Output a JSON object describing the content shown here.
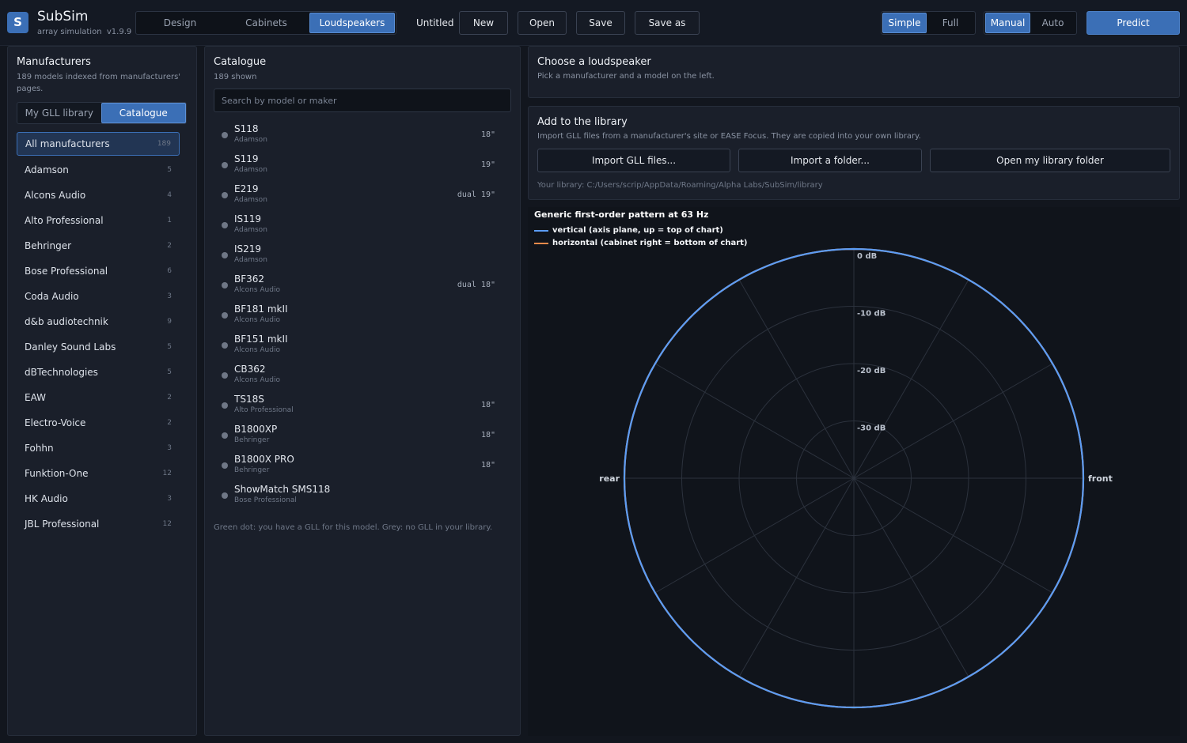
{
  "app": {
    "logo_letter": "S",
    "name": "SubSim",
    "subtitle": "array simulation",
    "version": "v1.9.9"
  },
  "topbar": {
    "mode_tabs": [
      {
        "label": "Design",
        "active": false
      },
      {
        "label": "Cabinets",
        "active": false
      },
      {
        "label": "Loudspeakers",
        "active": true
      }
    ],
    "document_title": "Untitled",
    "buttons": {
      "new": "New",
      "open": "Open",
      "save": "Save",
      "save_as": "Save as"
    },
    "view_toggle": [
      {
        "label": "Simple",
        "active": true
      },
      {
        "label": "Full",
        "active": false
      }
    ],
    "calc_toggle": [
      {
        "label": "Manual",
        "active": true
      },
      {
        "label": "Auto",
        "active": false
      }
    ],
    "predict": "Predict"
  },
  "manufacturers": {
    "title": "Manufacturers",
    "subtitle": "189 models indexed from manufacturers' pages.",
    "toggle": [
      {
        "label": "My GLL library",
        "active": false
      },
      {
        "label": "Catalogue",
        "active": true
      }
    ],
    "items": [
      {
        "name": "All manufacturers",
        "count": "189",
        "active": true
      },
      {
        "name": "Adamson",
        "count": "5"
      },
      {
        "name": "Alcons Audio",
        "count": "4"
      },
      {
        "name": "Alto Professional",
        "count": "1"
      },
      {
        "name": "Behringer",
        "count": "2"
      },
      {
        "name": "Bose Professional",
        "count": "6"
      },
      {
        "name": "Coda Audio",
        "count": "3"
      },
      {
        "name": "d&b audiotechnik",
        "count": "9"
      },
      {
        "name": "Danley Sound Labs",
        "count": "5"
      },
      {
        "name": "dBTechnologies",
        "count": "5"
      },
      {
        "name": "EAW",
        "count": "2"
      },
      {
        "name": "Electro-Voice",
        "count": "2"
      },
      {
        "name": "Fohhn",
        "count": "3"
      },
      {
        "name": "Funktion-One",
        "count": "12"
      },
      {
        "name": "HK Audio",
        "count": "3"
      },
      {
        "name": "JBL Professional",
        "count": "12"
      }
    ]
  },
  "catalogue": {
    "title": "Catalogue",
    "subtitle": "189 shown",
    "search_placeholder": "Search by model or maker",
    "items": [
      {
        "model": "S118",
        "maker": "Adamson",
        "size": "18\""
      },
      {
        "model": "S119",
        "maker": "Adamson",
        "size": "19\""
      },
      {
        "model": "E219",
        "maker": "Adamson",
        "size": "dual 19\""
      },
      {
        "model": "IS119",
        "maker": "Adamson",
        "size": ""
      },
      {
        "model": "IS219",
        "maker": "Adamson",
        "size": ""
      },
      {
        "model": "BF362",
        "maker": "Alcons Audio",
        "size": "dual 18\""
      },
      {
        "model": "BF181 mkII",
        "maker": "Alcons Audio",
        "size": ""
      },
      {
        "model": "BF151 mkII",
        "maker": "Alcons Audio",
        "size": ""
      },
      {
        "model": "CB362",
        "maker": "Alcons Audio",
        "size": ""
      },
      {
        "model": "TS18S",
        "maker": "Alto Professional",
        "size": "18\""
      },
      {
        "model": "B1800XP",
        "maker": "Behringer",
        "size": "18\""
      },
      {
        "model": "B1800X PRO",
        "maker": "Behringer",
        "size": "18\""
      },
      {
        "model": "ShowMatch SMS118",
        "maker": "Bose Professional",
        "size": ""
      }
    ],
    "note": "Green dot: you have a GLL for this model.  Grey: no GLL in your library."
  },
  "choose": {
    "title": "Choose a loudspeaker",
    "subtitle": "Pick a manufacturer and a model on the left."
  },
  "library": {
    "title": "Add to the library",
    "subtitle": "Import GLL files from a manufacturer's site or EASE Focus. They are copied into your own library.",
    "buttons": {
      "import_files": "Import GLL files...",
      "import_folder": "Import a folder...",
      "open_folder": "Open my library folder"
    },
    "path": "Your library: C:/Users/scrip/AppData/Roaming/Alpha Labs/SubSim/library"
  },
  "colors": {
    "accent": "#3b6fb6",
    "vertical": "#5b9cf5",
    "horizontal": "#f08a4b"
  },
  "chart_data": {
    "type": "polar",
    "title": "Generic first-order pattern at 63 Hz",
    "radial_unit": "dB",
    "radial_range": [
      -40,
      0
    ],
    "radial_ticks": [
      0,
      -10,
      -20,
      -30
    ],
    "radial_tick_labels": [
      "0 dB",
      "-10 dB",
      "-20 dB",
      "-30 dB"
    ],
    "angular_grid_step_deg": 30,
    "direction_labels": {
      "front": "front",
      "rear": "rear"
    },
    "series": [
      {
        "name": "vertical  (axis plane, up = top of chart)",
        "color": "#5b9cf5",
        "angles_deg": [
          0,
          30,
          60,
          90,
          120,
          150,
          180,
          210,
          240,
          270,
          300,
          330
        ],
        "values_db": [
          0,
          0,
          0,
          0,
          0,
          0,
          0,
          0,
          0,
          0,
          0,
          0
        ]
      },
      {
        "name": "horizontal  (cabinet right = bottom of chart)",
        "color": "#f08a4b",
        "angles_deg": [
          0,
          30,
          60,
          90,
          120,
          150,
          180,
          210,
          240,
          270,
          300,
          330
        ],
        "values_db": [
          0,
          0,
          0,
          0,
          0,
          0,
          0,
          0,
          0,
          0,
          0,
          0
        ]
      }
    ]
  }
}
